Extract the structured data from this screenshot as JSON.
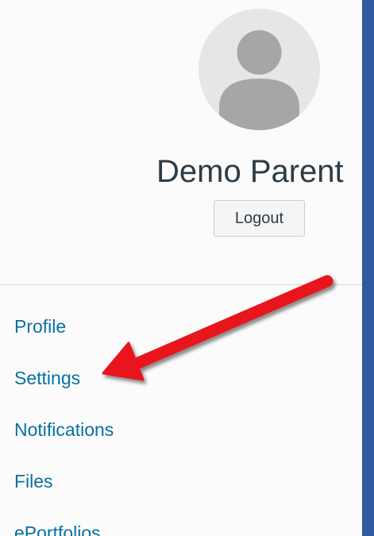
{
  "profile": {
    "user_name": "Demo Parent",
    "logout_label": "Logout"
  },
  "nav": {
    "items": [
      {
        "label": "Profile"
      },
      {
        "label": "Settings"
      },
      {
        "label": "Notifications"
      },
      {
        "label": "Files"
      },
      {
        "label": "ePortfolios"
      }
    ]
  },
  "annotation": {
    "arrow_color": "#e8141b",
    "points_to": "Settings"
  },
  "icons": {
    "avatar": "user-silhouette-icon"
  },
  "colors": {
    "link": "#0770a3",
    "frame_border": "#2f5aa0"
  }
}
